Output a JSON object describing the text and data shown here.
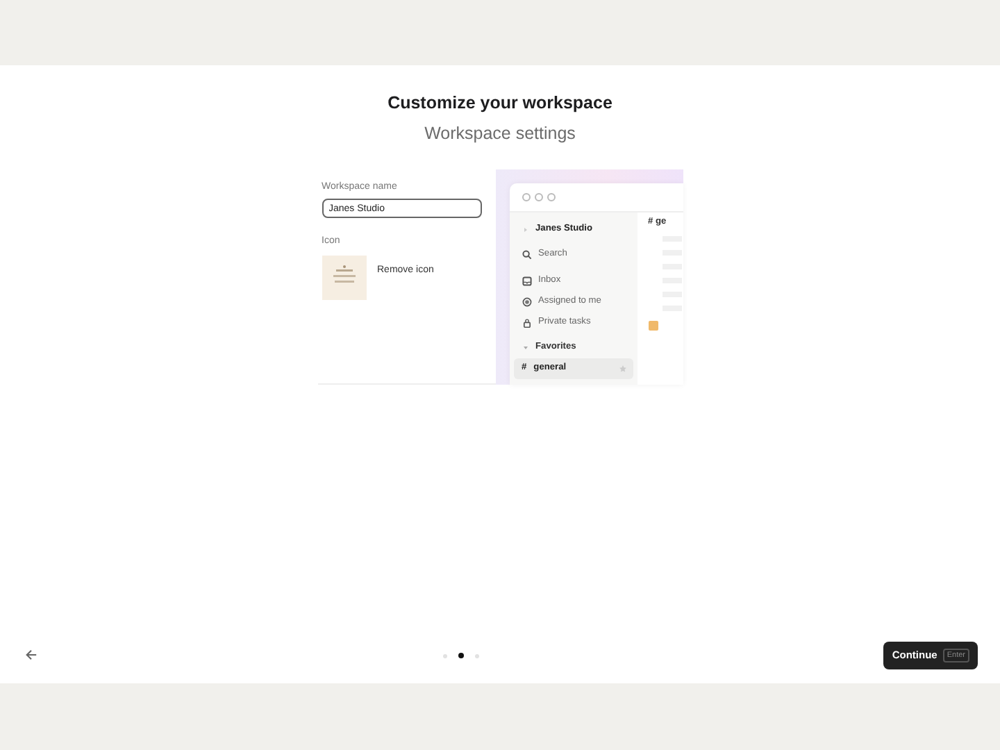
{
  "title": "Customize your workspace",
  "subtitle": "Workspace settings",
  "form": {
    "name_label": "Workspace name",
    "name_value": "Janes Studio",
    "icon_label": "Icon",
    "remove_button": "Remove icon"
  },
  "preview": {
    "workspace": "Janes Studio",
    "items": [
      {
        "kind": "search",
        "label": "Search"
      },
      {
        "kind": "inbox",
        "label": "Inbox"
      },
      {
        "kind": "assigned",
        "label": "Assigned to me"
      },
      {
        "kind": "private",
        "label": "Private tasks"
      }
    ],
    "section": {
      "label": "Favorites",
      "expanded": true
    },
    "channels": [
      {
        "prefix": "#",
        "label": "general",
        "selected": true
      }
    ],
    "column_header": "# ge"
  },
  "pager": [
    {
      "selected": false
    },
    {
      "selected": true
    },
    {
      "selected": false
    }
  ],
  "continue_button": {
    "label": "Continue",
    "shortcut": "Enter"
  }
}
